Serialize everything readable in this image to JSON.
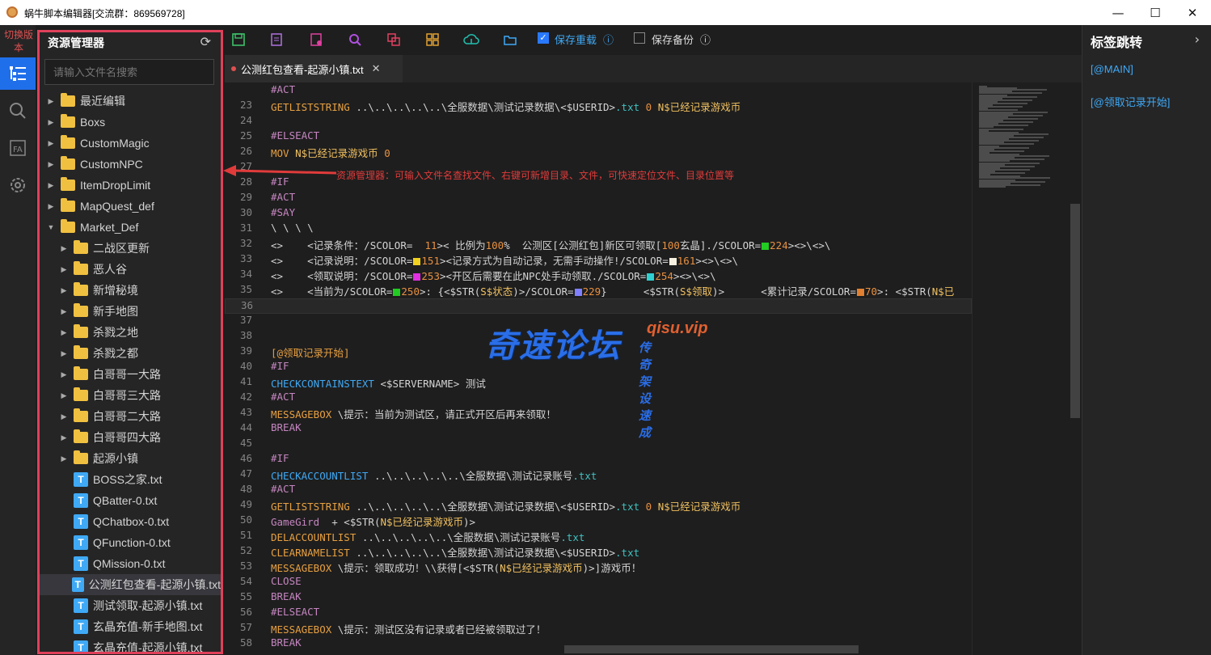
{
  "window": {
    "title": "蜗牛脚本编辑器[交流群：869569728]",
    "minimize_label": "—",
    "maximize_label": "☐",
    "close_label": "✕"
  },
  "activity": {
    "switch_label": "切换版本",
    "items": [
      "explorer-icon",
      "search-icon",
      "font-icon",
      "settings-icon"
    ]
  },
  "sidebar": {
    "title": "资源管理器",
    "search_placeholder": "请输入文件名搜索",
    "items": [
      {
        "label": "最近编辑",
        "type": "folder",
        "depth": 0,
        "expanded": false
      },
      {
        "label": "Boxs",
        "type": "folder",
        "depth": 0,
        "expanded": false
      },
      {
        "label": "CustomMagic",
        "type": "folder",
        "depth": 0,
        "expanded": false
      },
      {
        "label": "CustomNPC",
        "type": "folder",
        "depth": 0,
        "expanded": false
      },
      {
        "label": "ItemDropLimit",
        "type": "folder",
        "depth": 0,
        "expanded": false
      },
      {
        "label": "MapQuest_def",
        "type": "folder",
        "depth": 0,
        "expanded": false
      },
      {
        "label": "Market_Def",
        "type": "folder",
        "depth": 0,
        "expanded": true
      },
      {
        "label": "二战区更新",
        "type": "folder",
        "depth": 1,
        "expanded": false
      },
      {
        "label": "恶人谷",
        "type": "folder",
        "depth": 1,
        "expanded": false
      },
      {
        "label": "新增秘境",
        "type": "folder",
        "depth": 1,
        "expanded": false
      },
      {
        "label": "新手地图",
        "type": "folder",
        "depth": 1,
        "expanded": false
      },
      {
        "label": "杀戮之地",
        "type": "folder",
        "depth": 1,
        "expanded": false
      },
      {
        "label": "杀戮之都",
        "type": "folder",
        "depth": 1,
        "expanded": false
      },
      {
        "label": "白哥哥一大路",
        "type": "folder",
        "depth": 1,
        "expanded": false
      },
      {
        "label": "白哥哥三大路",
        "type": "folder",
        "depth": 1,
        "expanded": false
      },
      {
        "label": "白哥哥二大路",
        "type": "folder",
        "depth": 1,
        "expanded": false
      },
      {
        "label": "白哥哥四大路",
        "type": "folder",
        "depth": 1,
        "expanded": false
      },
      {
        "label": "起源小镇",
        "type": "folder",
        "depth": 1,
        "expanded": false
      },
      {
        "label": "BOSS之家.txt",
        "type": "file",
        "depth": 1
      },
      {
        "label": "QBatter-0.txt",
        "type": "file",
        "depth": 1
      },
      {
        "label": "QChatbox-0.txt",
        "type": "file",
        "depth": 1
      },
      {
        "label": "QFunction-0.txt",
        "type": "file",
        "depth": 1
      },
      {
        "label": "QMission-0.txt",
        "type": "file",
        "depth": 1
      },
      {
        "label": "公测红包查看-起源小镇.txt",
        "type": "file",
        "depth": 1,
        "selected": true
      },
      {
        "label": "测试领取-起源小镇.txt",
        "type": "file",
        "depth": 1
      },
      {
        "label": "玄晶充值-新手地图.txt",
        "type": "file",
        "depth": 1
      },
      {
        "label": "玄晶充值-起源小镇.txt",
        "type": "file",
        "depth": 1
      }
    ]
  },
  "toolbar": {
    "icons": [
      "save-icon",
      "edit-doc-icon",
      "close-doc-icon",
      "find-icon",
      "copy-icon",
      "grid-icon",
      "upload-icon",
      "folder-open-icon"
    ],
    "save_reload_label": "保存重载",
    "save_reload_checked": true,
    "save_backup_label": "保存备份",
    "save_backup_checked": false
  },
  "tab": {
    "label": "公测红包查看-起源小镇.txt",
    "close": "✕"
  },
  "annotation": {
    "text": "资源管理器：可输入文件名查找文件、右键可新增目录、文件，可快速定位文件、目录位置等"
  },
  "watermark": {
    "main": "奇速论坛",
    "site": "qisu.vip",
    "sub": "传奇架设速成"
  },
  "right_panel": {
    "title": "标签跳转",
    "links": [
      "[@MAIN]",
      "[@领取记录开始]"
    ]
  },
  "editor": {
    "current_line": 36,
    "lines": [
      {
        "n": "",
        "t": [
          [
            "kw",
            "#ACT"
          ]
        ]
      },
      {
        "n": "23",
        "t": [
          [
            "cmd",
            "GETLISTSTRING "
          ],
          [
            "par",
            "..\\..\\..\\..\\..\\全服数据\\测试记录数据\\<$USERID>"
          ],
          [
            "cy",
            ".txt"
          ],
          [
            "num",
            " 0 "
          ],
          [
            "var",
            "N$已经记录游戏币"
          ]
        ]
      },
      {
        "n": "24",
        "t": []
      },
      {
        "n": "25",
        "t": [
          [
            "kw",
            "#ELSEACT"
          ]
        ]
      },
      {
        "n": "26",
        "t": [
          [
            "cmd",
            "MOV "
          ],
          [
            "var",
            "N$已经记录游戏币"
          ],
          [
            "num",
            " 0"
          ]
        ]
      },
      {
        "n": "27",
        "t": []
      },
      {
        "n": "28",
        "t": [
          [
            "kw",
            "#IF"
          ]
        ]
      },
      {
        "n": "29",
        "t": [
          [
            "kw",
            "#ACT"
          ]
        ]
      },
      {
        "n": "30",
        "t": [
          [
            "kw",
            "#SAY"
          ]
        ]
      },
      {
        "n": "31",
        "t": [
          [
            "par",
            "\\ \\ \\ \\"
          ]
        ]
      },
      {
        "n": "32",
        "t": [
          [
            "par",
            "<>    <记录条件：/SCOLOR= "
          ],
          [
            "num",
            " 11"
          ],
          [
            "par",
            ">< 比例为"
          ],
          [
            "num",
            "100"
          ],
          [
            "par",
            "%  公测区[公测红包]新区可领取["
          ],
          [
            "num",
            "100"
          ],
          [
            "par",
            "玄晶]./SCOLOR="
          ],
          [
            "sw",
            "#22cc22"
          ],
          [
            "num",
            "224"
          ],
          [
            "par",
            "><>\\<>\\"
          ]
        ]
      },
      {
        "n": "33",
        "t": [
          [
            "par",
            "<>    <记录说明：/SCOLOR="
          ],
          [
            "sw",
            "#f0d020"
          ],
          [
            "num",
            "151"
          ],
          [
            "par",
            "><记录方式为自动记录，无需手动操作!/SCOLOR="
          ],
          [
            "sw",
            "#f5f0e0"
          ],
          [
            "num",
            "161"
          ],
          [
            "par",
            "><>\\<>\\"
          ]
        ]
      },
      {
        "n": "34",
        "t": [
          [
            "par",
            "<>    <领取说明：/SCOLOR="
          ],
          [
            "sw",
            "#e030e0"
          ],
          [
            "num",
            "253"
          ],
          [
            "par",
            "><开区后需要在此NPC处手动领取./SCOLOR="
          ],
          [
            "sw",
            "#30d0d0"
          ],
          [
            "num",
            "254"
          ],
          [
            "par",
            "><>\\<>\\"
          ]
        ]
      },
      {
        "n": "35",
        "t": [
          [
            "par",
            "<>    <当前为/SCOLOR="
          ],
          [
            "sw",
            "#22cc22"
          ],
          [
            "num",
            "250"
          ],
          [
            "par",
            ">: {<$STR("
          ],
          [
            "var",
            "S$状态"
          ],
          [
            "par",
            ")>/SCOLOR="
          ],
          [
            "sw",
            "#8080ff"
          ],
          [
            "num",
            "229"
          ],
          [
            "par",
            "}      <$STR("
          ],
          [
            "var",
            "S$领取"
          ],
          [
            "par",
            ")>      <累计记录/SCOLOR="
          ],
          [
            "sw",
            "#e08030"
          ],
          [
            "num",
            "70"
          ],
          [
            "par",
            ">: <$STR("
          ],
          [
            "var",
            "N$已"
          ]
        ]
      },
      {
        "n": "36",
        "t": []
      },
      {
        "n": "37",
        "t": []
      },
      {
        "n": "38",
        "t": []
      },
      {
        "n": "39",
        "t": [
          [
            "sec",
            "[@领取记录开始]"
          ]
        ]
      },
      {
        "n": "40",
        "t": [
          [
            "kw",
            "#IF"
          ]
        ]
      },
      {
        "n": "41",
        "t": [
          [
            "blue",
            "CHECKCONTAINSTEXT "
          ],
          [
            "par",
            "<$SERVERNAME> 测试"
          ]
        ]
      },
      {
        "n": "42",
        "t": [
          [
            "kw",
            "#ACT"
          ]
        ]
      },
      {
        "n": "43",
        "t": [
          [
            "cmd",
            "MESSAGEBOX "
          ],
          [
            "par",
            "\\提示：当前为测试区，请正式开区后再来领取！"
          ]
        ]
      },
      {
        "n": "44",
        "t": [
          [
            "kw",
            "BREAK"
          ]
        ]
      },
      {
        "n": "45",
        "t": []
      },
      {
        "n": "46",
        "t": [
          [
            "kw",
            "#IF"
          ]
        ]
      },
      {
        "n": "47",
        "t": [
          [
            "blue",
            "CHECKACCOUNTLIST "
          ],
          [
            "par",
            "..\\..\\..\\..\\..\\全服数据\\测试记录账号"
          ],
          [
            "cy",
            ".txt"
          ]
        ]
      },
      {
        "n": "48",
        "t": [
          [
            "kw",
            "#ACT"
          ]
        ]
      },
      {
        "n": "49",
        "t": [
          [
            "cmd",
            "GETLISTSTRING "
          ],
          [
            "par",
            "..\\..\\..\\..\\..\\全服数据\\测试记录数据\\<$USERID>"
          ],
          [
            "cy",
            ".txt"
          ],
          [
            "num",
            " 0 "
          ],
          [
            "var",
            "N$已经记录游戏币"
          ]
        ]
      },
      {
        "n": "50",
        "t": [
          [
            "kw",
            "GameGird "
          ],
          [
            "par",
            " + <$STR("
          ],
          [
            "var",
            "N$已经记录游戏币"
          ],
          [
            "par",
            ")>"
          ]
        ]
      },
      {
        "n": "51",
        "t": [
          [
            "cmd",
            "DELACCOUNTLIST "
          ],
          [
            "par",
            "..\\..\\..\\..\\..\\全服数据\\测试记录账号"
          ],
          [
            "cy",
            ".txt"
          ]
        ]
      },
      {
        "n": "52",
        "t": [
          [
            "cmd",
            "CLEARNAMELIST "
          ],
          [
            "par",
            "..\\..\\..\\..\\..\\全服数据\\测试记录数据\\<$USERID>"
          ],
          [
            "cy",
            ".txt"
          ]
        ]
      },
      {
        "n": "53",
        "t": [
          [
            "cmd",
            "MESSAGEBOX "
          ],
          [
            "par",
            "\\提示：领取成功！\\\\获得[<$STR("
          ],
          [
            "var",
            "N$已经记录游戏币"
          ],
          [
            "par",
            ")>]游戏币！"
          ]
        ]
      },
      {
        "n": "54",
        "t": [
          [
            "kw",
            "CLOSE"
          ]
        ]
      },
      {
        "n": "55",
        "t": [
          [
            "kw",
            "BREAK"
          ]
        ]
      },
      {
        "n": "56",
        "t": [
          [
            "kw",
            "#ELSEACT"
          ]
        ]
      },
      {
        "n": "57",
        "t": [
          [
            "cmd",
            "MESSAGEBOX "
          ],
          [
            "par",
            "\\提示：测试区没有记录或者已经被领取过了！"
          ]
        ]
      },
      {
        "n": "58",
        "t": [
          [
            "kw",
            "BREAK"
          ]
        ]
      }
    ]
  },
  "colors": {
    "accent": "#1f6feb",
    "highlight_border": "#e0405a",
    "annotation": "#e03b3b"
  }
}
